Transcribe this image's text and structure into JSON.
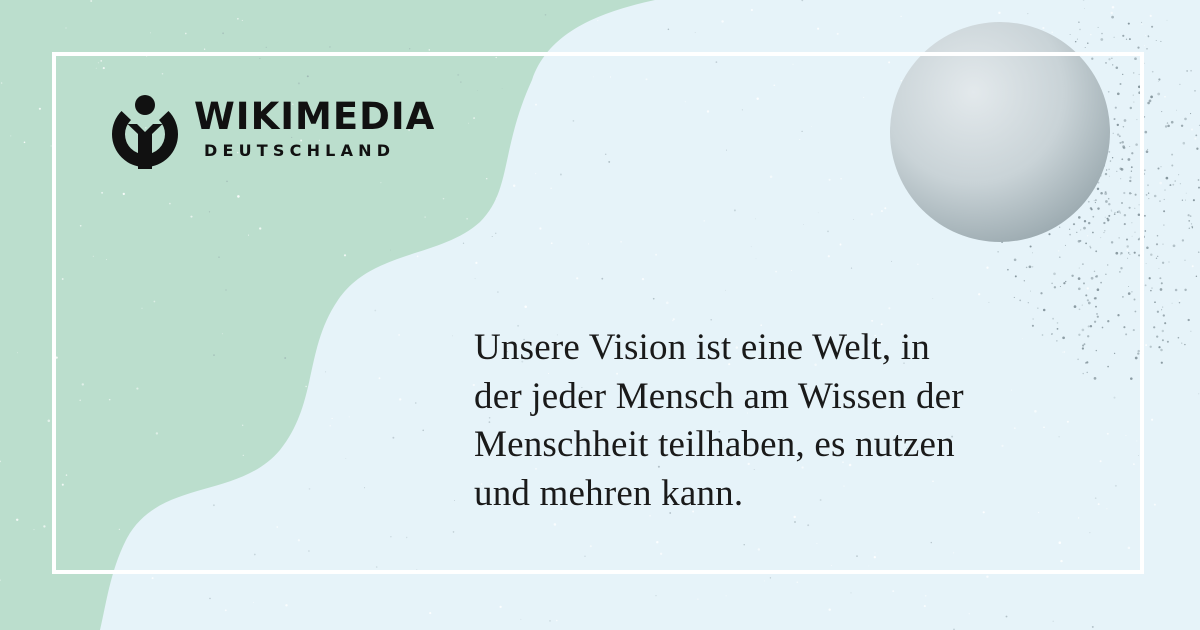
{
  "brand": {
    "name": "WIKIMEDIA",
    "subtitle": "DEUTSCHLAND",
    "logo_icon": "wikimedia-logo-icon"
  },
  "quote": {
    "lines": [
      "Unsere Vision ist eine Welt, in",
      "der jeder Mensch am Wissen der",
      "Menschheit teilhaben, es nutzen",
      "und mehren kann."
    ]
  },
  "colors": {
    "background": "#e6f3f9",
    "mint_shape": "#bbdecd",
    "frame": "#ffffff",
    "text": "#1a1a1a",
    "logo": "#111111"
  }
}
